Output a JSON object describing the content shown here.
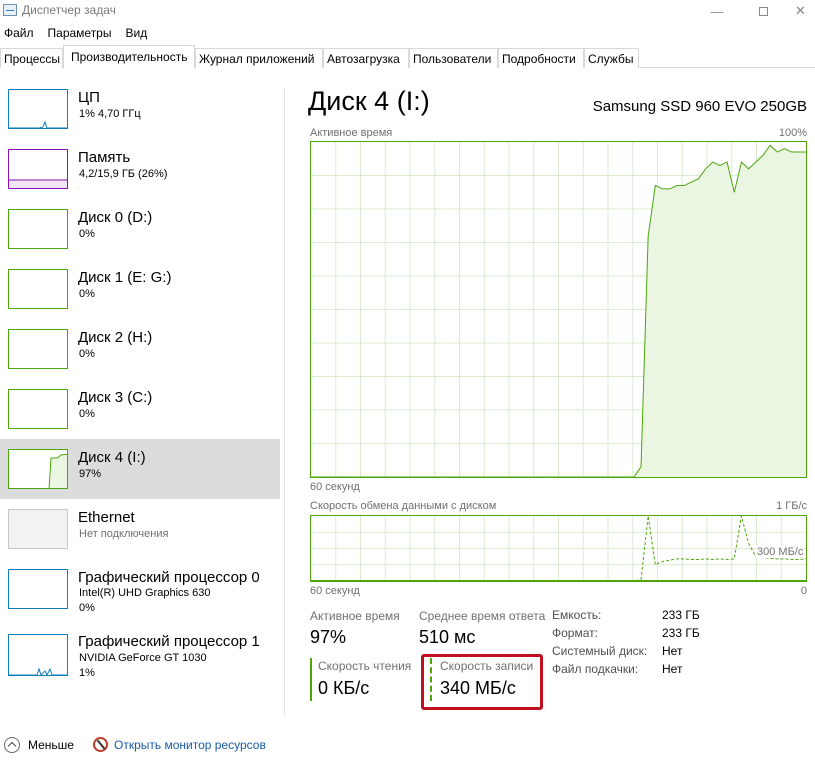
{
  "window": {
    "title": "Диспетчер задач",
    "minimize_glyph": "—",
    "close_glyph": "✕"
  },
  "menu": [
    "Файл",
    "Параметры",
    "Вид"
  ],
  "tabs": [
    {
      "label": "Процессы",
      "active": false
    },
    {
      "label": "Производительность",
      "active": true
    },
    {
      "label": "Журнал приложений",
      "active": false
    },
    {
      "label": "Автозагрузка",
      "active": false
    },
    {
      "label": "Пользователи",
      "active": false
    },
    {
      "label": "Подробности",
      "active": false
    },
    {
      "label": "Службы",
      "active": false
    }
  ],
  "resources": [
    {
      "name": "ЦП",
      "line1": "1% 4,70 ГГц",
      "line2": "",
      "color": "#117dbb",
      "kind": "cpu",
      "selected": false
    },
    {
      "name": "Память",
      "line1": "4,2/15,9 ГБ (26%)",
      "line2": "",
      "color": "#8b12ae",
      "kind": "mem",
      "selected": false
    },
    {
      "name": "Диск 0 (D:)",
      "line1": "0%",
      "line2": "",
      "color": "#4da60c",
      "kind": "flat",
      "selected": false
    },
    {
      "name": "Диск 1 (E: G:)",
      "line1": "0%",
      "line2": "",
      "color": "#4da60c",
      "kind": "flat",
      "selected": false
    },
    {
      "name": "Диск 2 (H:)",
      "line1": "0%",
      "line2": "",
      "color": "#4da60c",
      "kind": "flat",
      "selected": false
    },
    {
      "name": "Диск 3 (C:)",
      "line1": "0%",
      "line2": "",
      "color": "#4da60c",
      "kind": "flat",
      "selected": false
    },
    {
      "name": "Диск 4 (I:)",
      "line1": "97%",
      "line2": "",
      "color": "#4da60c",
      "kind": "disk4",
      "selected": true
    },
    {
      "name": "Ethernet",
      "line1": "Нет подключения",
      "line2": "",
      "color": "#c8c8c8",
      "kind": "eth",
      "selected": false
    },
    {
      "name": "Графический процессор 0",
      "line1": "Intel(R) UHD Graphics 630",
      "line2": "0%",
      "color": "#117dbb",
      "kind": "gpu0",
      "selected": false
    },
    {
      "name": "Графический процессор 1",
      "line1": "NVIDIA GeForce GT 1030",
      "line2": "1%",
      "color": "#117dbb",
      "kind": "gpu1",
      "selected": false
    }
  ],
  "detail": {
    "title": "Диск 4 (I:)",
    "model": "Samsung SSD 960 EVO 250GB",
    "active_chart": {
      "label": "Активное время",
      "max_label": "100%",
      "time_label": "60 секунд",
      "min_label": "",
      "color": "#4da60c",
      "fill": "#eaf5e2",
      "values": [
        0,
        0,
        0,
        0,
        0,
        0,
        0,
        0,
        0,
        0,
        0,
        0,
        0,
        0,
        0,
        0,
        0,
        0,
        0,
        0,
        0,
        0,
        0,
        0,
        0,
        0,
        0,
        0,
        0,
        0,
        0,
        0,
        0,
        0,
        0,
        0,
        0,
        0,
        0,
        0,
        0,
        0,
        0,
        0,
        0,
        0,
        3,
        72,
        87,
        86,
        86,
        87,
        87,
        88,
        89,
        92,
        94,
        93,
        94,
        85,
        94,
        92,
        94,
        96,
        99,
        97,
        98,
        97,
        97,
        97
      ]
    },
    "transfer_chart": {
      "label": "Скорость обмена данными с диском",
      "max_label": "1 ГБ/с",
      "time_label": "60 секунд",
      "min_label": "0",
      "annotation": "300 МБ/с",
      "color": "#4da60c",
      "read_values": [
        0,
        0,
        0,
        0,
        0,
        0,
        0,
        0,
        0,
        0,
        0,
        0,
        0,
        0,
        0,
        0,
        0,
        0,
        0,
        0,
        0,
        0,
        0,
        0,
        0,
        0,
        0,
        0,
        0,
        0,
        0,
        0,
        0,
        0,
        0,
        0,
        0,
        0,
        0,
        0,
        0,
        0,
        0,
        0,
        0,
        0,
        0,
        0,
        0,
        0,
        0,
        0,
        0,
        0,
        0,
        0,
        0,
        0,
        0,
        0,
        0,
        0,
        0,
        0,
        0,
        0,
        0,
        0,
        0,
        0
      ],
      "write_values": [
        0,
        0,
        0,
        0,
        0,
        0,
        0,
        0,
        0,
        0,
        0,
        0,
        0,
        0,
        0,
        0,
        0,
        0,
        0,
        0,
        0,
        0,
        0,
        0,
        0,
        0,
        0,
        0,
        0,
        0,
        0,
        0,
        0,
        0,
        0,
        0,
        0,
        0,
        0,
        0,
        0,
        0,
        0,
        0,
        0,
        0,
        2,
        100,
        25,
        30,
        32,
        34,
        34,
        33,
        33,
        34,
        33,
        34,
        33,
        34,
        100,
        58,
        38,
        36,
        35,
        34,
        34,
        33,
        33,
        34
      ]
    },
    "stats": {
      "active_time_label": "Активное время",
      "active_time_value": "97%",
      "response_label": "Среднее время ответа",
      "response_value": "510 мс",
      "read_label": "Скорость чтения",
      "read_value": "0 КБ/с",
      "write_label": "Скорость записи",
      "write_value": "340 МБ/с"
    },
    "properties": [
      {
        "label": "Емкость:",
        "value": "233 ГБ"
      },
      {
        "label": "Формат:",
        "value": "233 ГБ"
      },
      {
        "label": "Системный диск:",
        "value": "Нет"
      },
      {
        "label": "Файл подкачки:",
        "value": "Нет"
      }
    ]
  },
  "footer": {
    "less_label": "Меньше",
    "monitor_label": "Открыть монитор ресурсов"
  }
}
